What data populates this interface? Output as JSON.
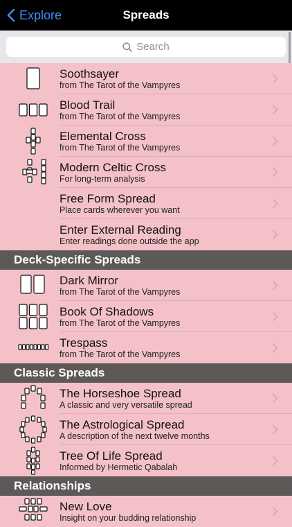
{
  "nav": {
    "back_label": "Explore",
    "title": "Spreads"
  },
  "search": {
    "placeholder": "Search"
  },
  "main_items": [
    {
      "title": "Soothsayer",
      "subtitle": "from The Tarot of the Vampyres",
      "icon": "one-card"
    },
    {
      "title": "Blood Trail",
      "subtitle": "from The Tarot of the Vampyres",
      "icon": "three-cards"
    },
    {
      "title": "Elemental Cross",
      "subtitle": "from The Tarot of the Vampyres",
      "icon": "cross"
    },
    {
      "title": "Modern Celtic Cross",
      "subtitle": "For long-term analysis",
      "icon": "celtic-cross"
    },
    {
      "title": "Free Form Spread",
      "subtitle": "Place cards wherever you want",
      "icon": "none"
    },
    {
      "title": "Enter External Reading",
      "subtitle": "Enter readings done outside the app",
      "icon": "none"
    }
  ],
  "sections": [
    {
      "header": "Deck-Specific Spreads",
      "items": [
        {
          "title": "Dark Mirror",
          "subtitle": "from The Tarot of the Vampyres",
          "icon": "two-cards"
        },
        {
          "title": "Book Of Shadows",
          "subtitle": "from The Tarot of the Vampyres",
          "icon": "six-cards"
        },
        {
          "title": "Trespass",
          "subtitle": "from The Tarot of the Vampyres",
          "icon": "row-cards"
        }
      ]
    },
    {
      "header": "Classic Spreads",
      "items": [
        {
          "title": "The Horseshoe Spread",
          "subtitle": "A classic and very versatile spread",
          "icon": "horseshoe"
        },
        {
          "title": "The Astrological Spread",
          "subtitle": "A description of the next twelve months",
          "icon": "circle"
        },
        {
          "title": "Tree Of Life Spread",
          "subtitle": "Informed by Hermetic Qabalah",
          "icon": "tree"
        }
      ]
    },
    {
      "header": "Relationships",
      "items": [
        {
          "title": "New Love",
          "subtitle": "Insight on your budding relationship",
          "icon": "new-love"
        }
      ]
    }
  ],
  "colors": {
    "background": "#f3c1c7",
    "section_header": "#5d5958",
    "accent": "#3d8ef5",
    "navbar": "#000000"
  }
}
